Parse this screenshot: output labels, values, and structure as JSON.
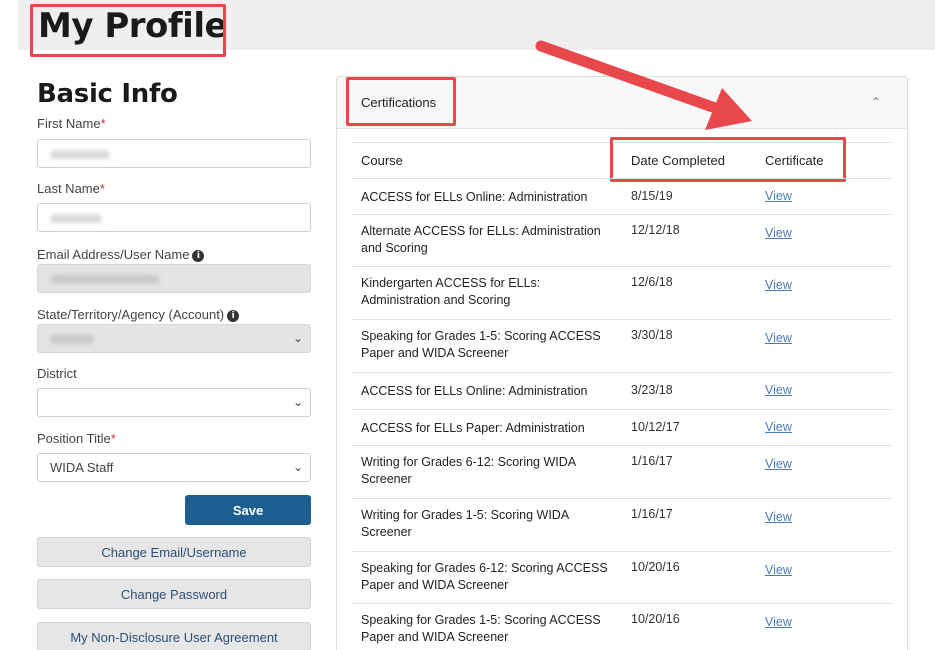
{
  "page": {
    "title": "My Profile"
  },
  "basic_info": {
    "title": "Basic Info",
    "first_name_label": "First Name",
    "last_name_label": "Last Name",
    "email_label": "Email Address/User Name",
    "state_label": "State/Territory/Agency (Account)",
    "district_label": "District",
    "district_value": "",
    "position_label": "Position Title",
    "position_value": "WIDA Staff",
    "required_mark": "*",
    "info_glyph": "i"
  },
  "buttons": {
    "save": "Save",
    "change_email": "Change Email/Username",
    "change_password": "Change Password",
    "nda": "My Non-Disclosure User Agreement"
  },
  "certifications": {
    "title": "Certifications",
    "columns": {
      "course": "Course",
      "date": "Date Completed",
      "certificate": "Certificate"
    },
    "rows": [
      {
        "course": "ACCESS for ELLs Online: Administration",
        "date": "8/15/19",
        "link": "View"
      },
      {
        "course": "Alternate ACCESS for ELLs: Administration and Scoring",
        "date": "12/12/18",
        "link": "View"
      },
      {
        "course": "Kindergarten ACCESS for ELLs: Administration and Scoring",
        "date": "12/6/18",
        "link": "View"
      },
      {
        "course": "Speaking for Grades 1-5: Scoring ACCESS Paper and WIDA Screener",
        "date": "3/30/18",
        "link": "View"
      },
      {
        "course": "ACCESS for ELLs Online: Administration",
        "date": "3/23/18",
        "link": "View"
      },
      {
        "course": "ACCESS for ELLs Paper: Administration",
        "date": "10/12/17",
        "link": "View"
      },
      {
        "course": "Writing for Grades 6-12: Scoring WIDA Screener",
        "date": "1/16/17",
        "link": "View"
      },
      {
        "course": "Writing for Grades 1-5: Scoring WIDA Screener",
        "date": "1/16/17",
        "link": "View"
      },
      {
        "course": "Speaking for Grades 6-12: Scoring ACCESS Paper and WIDA Screener",
        "date": "10/20/16",
        "link": "View"
      },
      {
        "course": "Speaking for Grades 1-5: Scoring ACCESS Paper and WIDA Screener",
        "date": "10/20/16",
        "link": "View"
      }
    ]
  },
  "icons": {
    "select_chevron": "chevron-down-icon",
    "panel_collapse": "chevron-up-icon",
    "info": "info-icon"
  },
  "colors": {
    "highlight": "#e8474c",
    "save_button": "#1d5e91",
    "link": "#4a7bb6"
  }
}
